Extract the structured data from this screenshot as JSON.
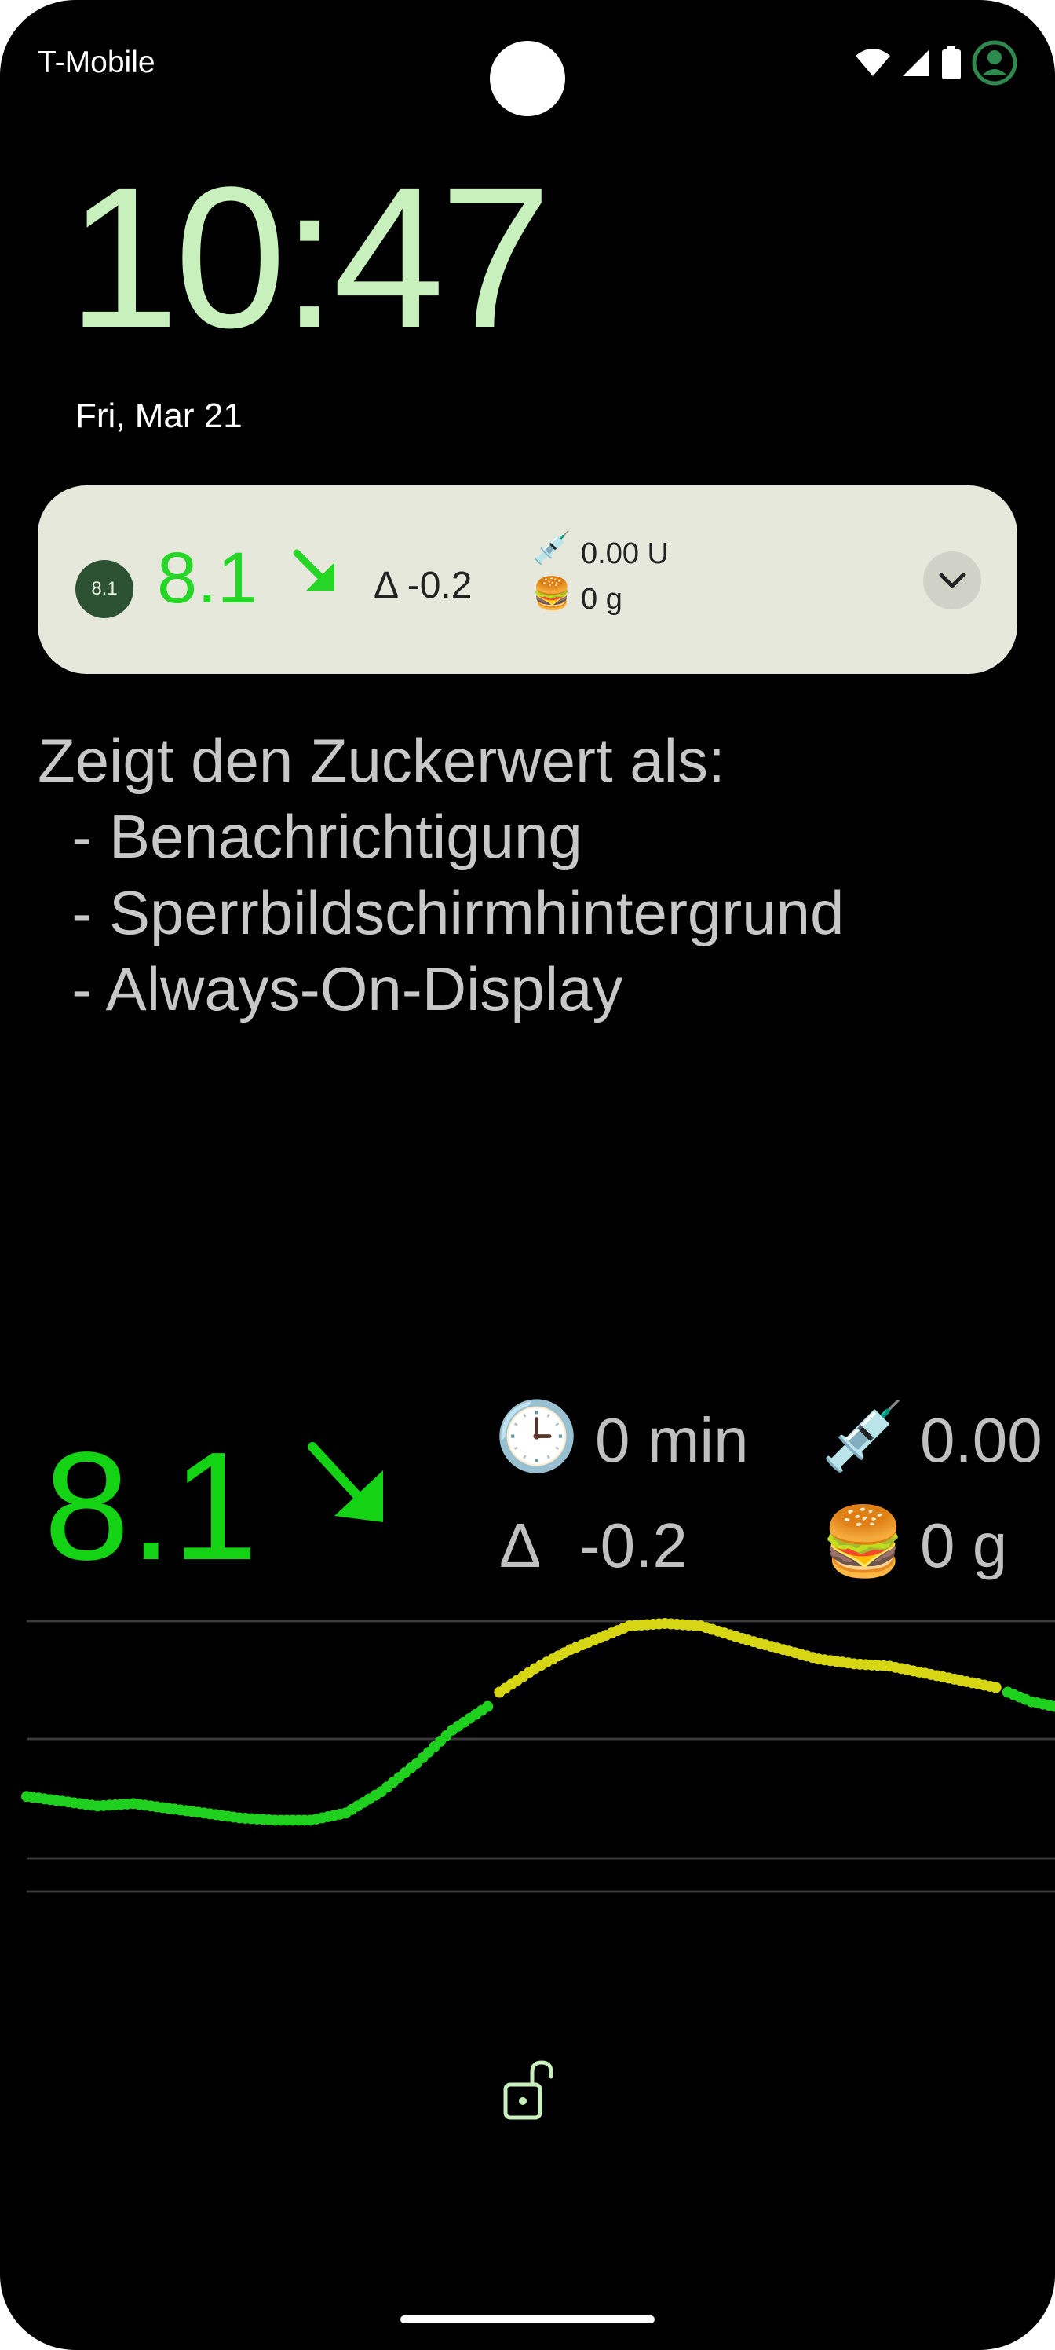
{
  "status_bar": {
    "carrier": "T-Mobile",
    "icons": [
      "wifi-icon",
      "cellular-signal-icon",
      "battery-icon",
      "account-icon"
    ]
  },
  "lockscreen": {
    "time": "10:47",
    "date": "Fri, Mar 21"
  },
  "notification": {
    "app_icon_text": "8.1",
    "value": "8.1",
    "trend": "falling-slowly",
    "delta": "Δ -0.2",
    "insulin": "0.00 U",
    "carbs": "0 g",
    "insulin_icon": "syringe-icon",
    "carbs_icon": "burger-icon",
    "expand_icon": "chevron-down-icon"
  },
  "description": {
    "lines": [
      "Zeigt den Zuckerwert als:",
      "  - Benachrichtigung",
      "  - Sperrbildschirmhintergrund",
      "  - Always-On-Display"
    ]
  },
  "wallpaper": {
    "value": "8.1",
    "trend": "falling-slowly",
    "age": "0 min",
    "delta_symbol": "Δ",
    "delta_value": "-0.2",
    "insulin": "0.00",
    "carbs": "0 g",
    "age_icon": "clock-icon",
    "insulin_icon": "syringe-icon",
    "carbs_icon": "burger-icon"
  },
  "colors": {
    "value_green": "#14d214",
    "in_range_dot": "#1fd01f",
    "high_dot": "#d6d614",
    "clock_green": "#c8f0bc",
    "notification_bg": "#e6e8dc"
  },
  "chart_data": {
    "type": "scatter",
    "title": "",
    "xlabel": "",
    "ylabel": "",
    "threshold_lines": [
      "upper",
      "target-high",
      "target-low"
    ],
    "series": [
      {
        "color": "#1fd01f",
        "points": [
          [
            0,
            6.2
          ],
          [
            3,
            6.1
          ],
          [
            6,
            6.0
          ],
          [
            9,
            6.05
          ],
          [
            12,
            5.95
          ],
          [
            15,
            5.85
          ],
          [
            18,
            5.75
          ],
          [
            21,
            5.7
          ],
          [
            24,
            5.7
          ],
          [
            27,
            5.85
          ],
          [
            30,
            6.3
          ],
          [
            33,
            6.9
          ],
          [
            36,
            7.6
          ],
          [
            39,
            8.1
          ],
          [
            83,
            8.4
          ],
          [
            85,
            8.2
          ],
          [
            87,
            8.1
          ]
        ]
      },
      {
        "color": "#d6d614",
        "points": [
          [
            40,
            8.4
          ],
          [
            43,
            8.9
          ],
          [
            46,
            9.3
          ],
          [
            49,
            9.6
          ],
          [
            51,
            9.8
          ],
          [
            54,
            9.85
          ],
          [
            57,
            9.8
          ],
          [
            61,
            9.5
          ],
          [
            64,
            9.3
          ],
          [
            67,
            9.1
          ],
          [
            70,
            9.0
          ],
          [
            73,
            8.95
          ],
          [
            76,
            8.8
          ],
          [
            79,
            8.65
          ],
          [
            82,
            8.5
          ]
        ]
      }
    ]
  }
}
